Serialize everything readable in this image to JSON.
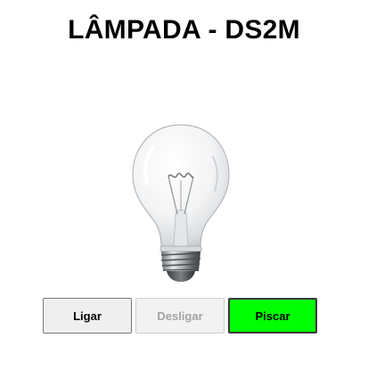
{
  "page": {
    "title": "LÂMPADA - DS2M"
  },
  "bulb": {
    "icon": "light-bulb-icon",
    "state": "off"
  },
  "controls": {
    "on_label": "Ligar",
    "off_label": "Desligar",
    "off_disabled": true,
    "blink_label": "Piscar",
    "blink_color": "#00ff00"
  }
}
